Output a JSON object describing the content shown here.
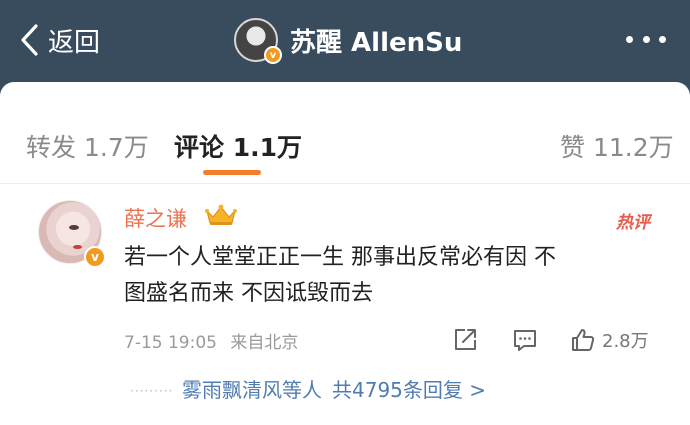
{
  "header": {
    "back_label": "返回",
    "title": "苏醒 AllenSu",
    "avatar_badge": "v",
    "bg_color": "#384c5e"
  },
  "tabs": {
    "repost": "转发 1.7万",
    "comment": "评论 1.1万",
    "like": "赞 11.2万",
    "active": "comment",
    "accent": "#f57c2b"
  },
  "comment": {
    "username": "薛之谦",
    "avatar_badge": "v",
    "hot_label": "热评",
    "text_line1": "若一个人堂堂正正一生 那事出反常必有因 不",
    "text_line2": "图盛名而来 不因诋毁而去",
    "time": "7-15 19:05",
    "location": "来自北京",
    "like_count": "2.8万",
    "name_color": "#eb7350"
  },
  "replies": {
    "leading_dots": "·········",
    "users_text": "雾雨飘清风等人",
    "count_text": "共4795条回复 >"
  },
  "icons": [
    "back-chevron-icon",
    "more-dots-icon",
    "crown-icon",
    "share-icon",
    "reply-icon",
    "thumbs-up-icon",
    "verified-badge-icon"
  ]
}
